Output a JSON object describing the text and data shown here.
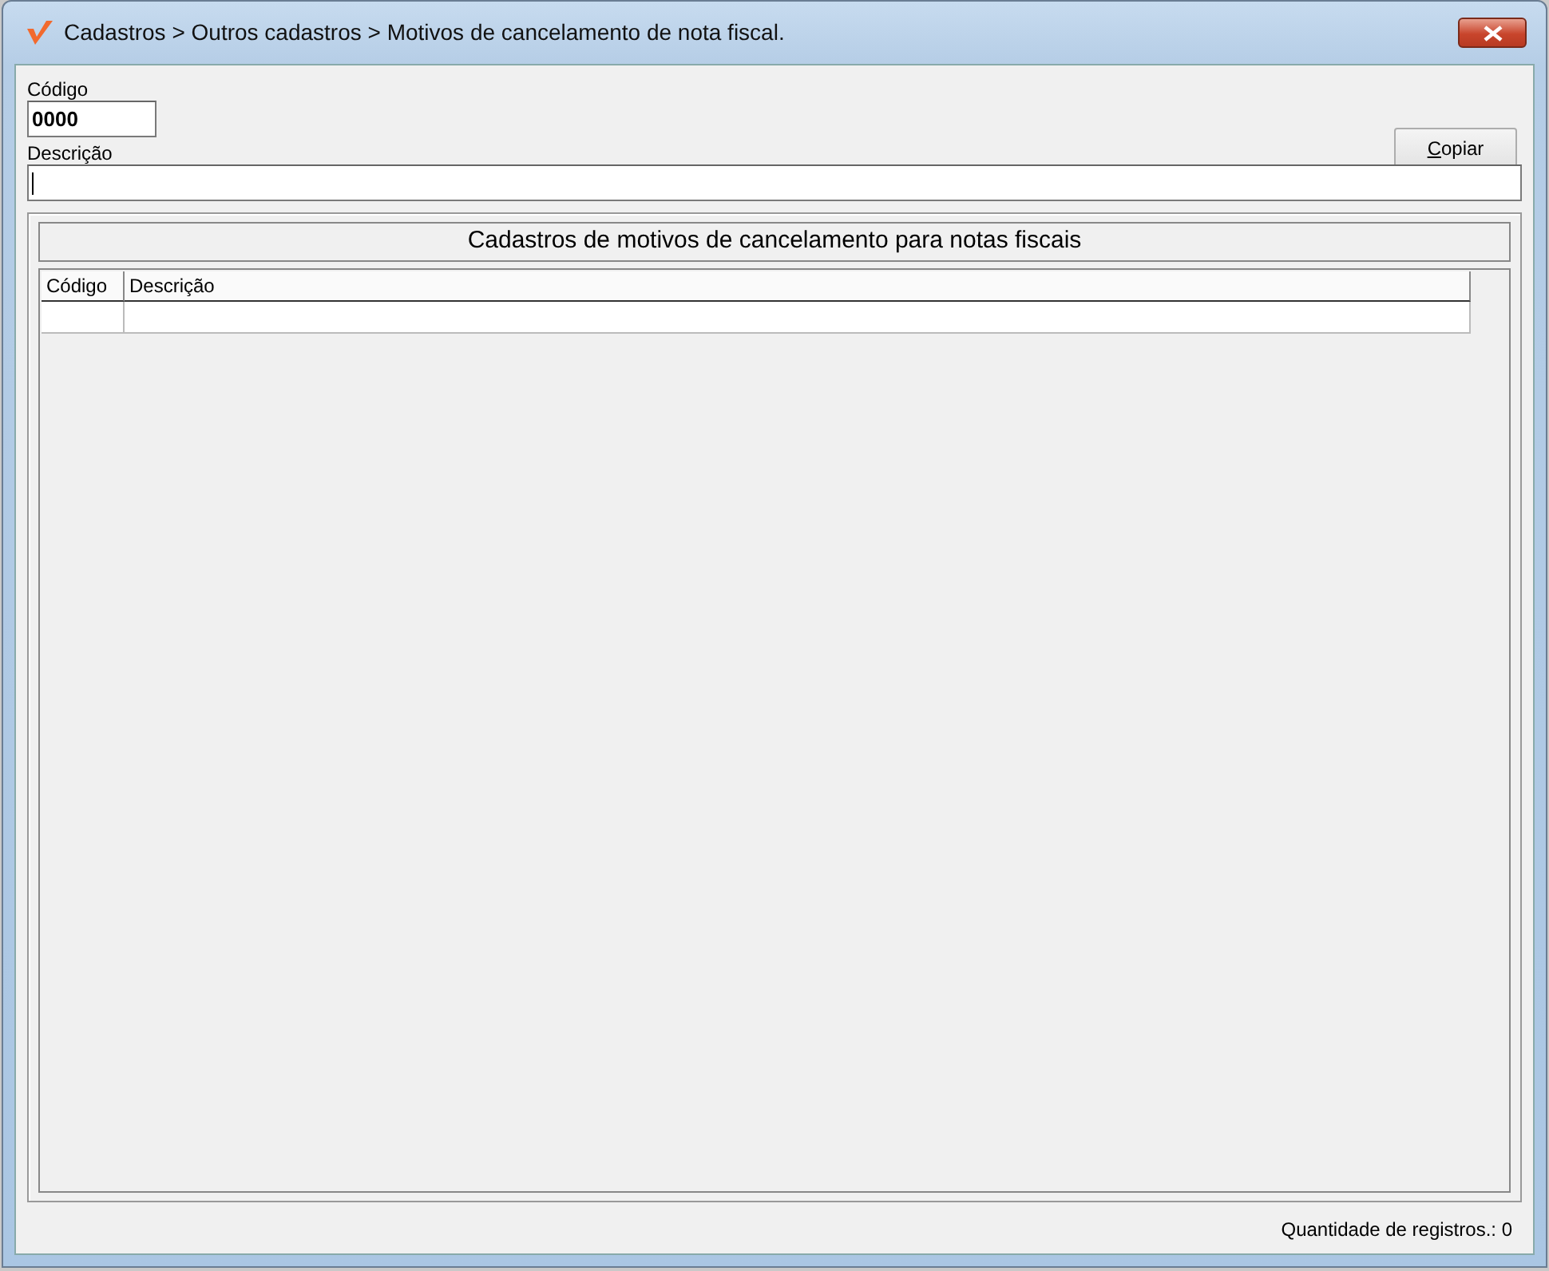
{
  "window": {
    "title": "Cadastros > Outros cadastros > Motivos de cancelamento de nota fiscal."
  },
  "form": {
    "codigo": {
      "label": "Código",
      "value": "0000"
    },
    "descricao": {
      "label": "Descrição",
      "focused": true
    },
    "copy_button": "Copiar"
  },
  "grid": {
    "title": "Cadastros de motivos de cancelamento para notas fiscais",
    "columns": [
      "Código",
      "Descrição"
    ]
  },
  "status_bar": "Quantidade de registros.: 0"
}
